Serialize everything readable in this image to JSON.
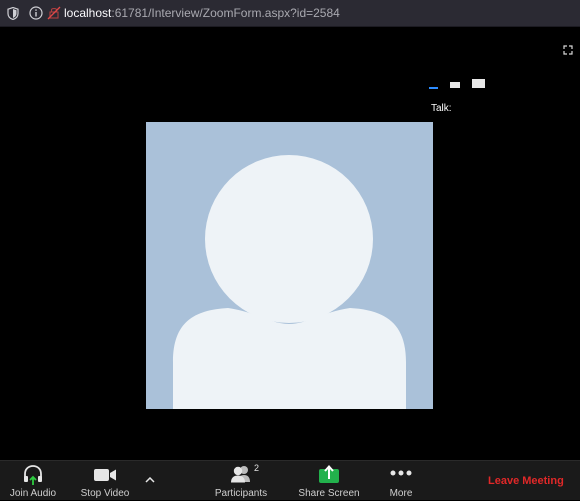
{
  "browser": {
    "url_host": "localhost",
    "url_rest": ":61781/Interview/ZoomForm.aspx?id=2584"
  },
  "meeting": {
    "talk_label": "Talk:"
  },
  "toolbar": {
    "join_audio": "Join Audio",
    "stop_video": "Stop Video",
    "participants": "Participants",
    "participants_count": "2",
    "share_screen": "Share Screen",
    "more": "More",
    "leave_meeting": "Leave Meeting"
  },
  "colors": {
    "avatar_bg": "#aac1d9",
    "avatar_fg": "#eef3f7",
    "share_green": "#22b14c",
    "leave_red": "#e02828"
  }
}
